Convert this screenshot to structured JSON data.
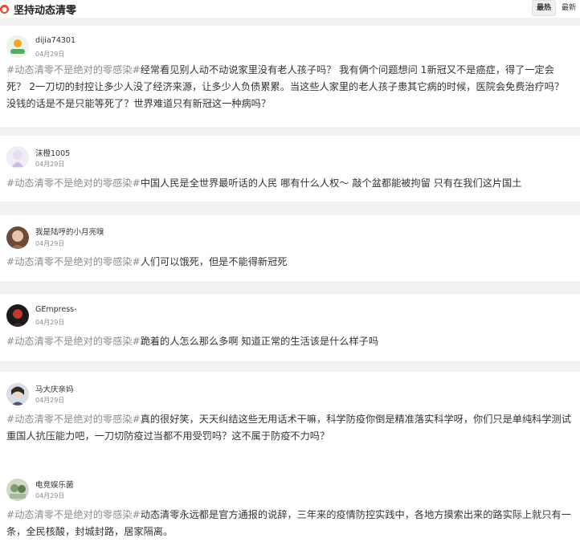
{
  "header": {
    "title": "坚持动态清零",
    "badge_icon": "circle-badge-icon",
    "sort": [
      "最热",
      "最新"
    ]
  },
  "comments": [
    {
      "username": "dijia74301",
      "date": "04月29日",
      "hashtag": "#动态清零不是绝对的零感染#",
      "text": "经常看见别人动不动说家里没有老人孩子吗？ 我有俩个问题想问 1新冠又不是癌症，得了一定会死？ 2一刀切的封控让多少人没了经济来源，让多少人负债累累。当这些人家里的老人孩子患其它病的时候，医院会免费治疗吗？没钱的话是不是只能等死了？世界难道只有新冠这一种病吗？"
    },
    {
      "username": "沫橙1005",
      "date": "04月29日",
      "hashtag": "#动态清零不是绝对的零感染#",
      "text": "中国人民是全世界最听话的人民 哪有什么人权～ 敲个盆都能被拘留 只有在我们这片国土"
    },
    {
      "username": "我是陆哼的小月亮嗅",
      "date": "04月29日",
      "hashtag": "#动态清零不是绝对的零感染#",
      "text": "人们可以饿死，但是不能得新冠死"
    },
    {
      "username": "GEmpress-",
      "date": "04月29日",
      "hashtag": "#动态清零不是绝对的零感染#",
      "text": "跪着的人怎么那么多啊 知道正常的生活该是什么样子吗"
    },
    {
      "username": "马大庆亲妈",
      "date": "04月29日",
      "hashtag": "#动态清零不是绝对的零感染#",
      "text": "真的很好笑，天天纠结这些无用话术干嘛，科学防疫你倒是精准落实科学呀，你们只是单纯科学测试重国人抗压能力吧，一刀切防疫过当都不用受罚吗？这不属于防疫不力吗？"
    },
    {
      "username": "电竞娱乐菌",
      "date": "04月29日",
      "hashtag": "#动态清零不是绝对的零感染#",
      "text": "动态清零永远都是官方通报的说辞，三年来的疫情防控实践中，各地方摸索出来的路实际上就只有一条，全民核酸，封城封路，居家隔离。"
    }
  ]
}
